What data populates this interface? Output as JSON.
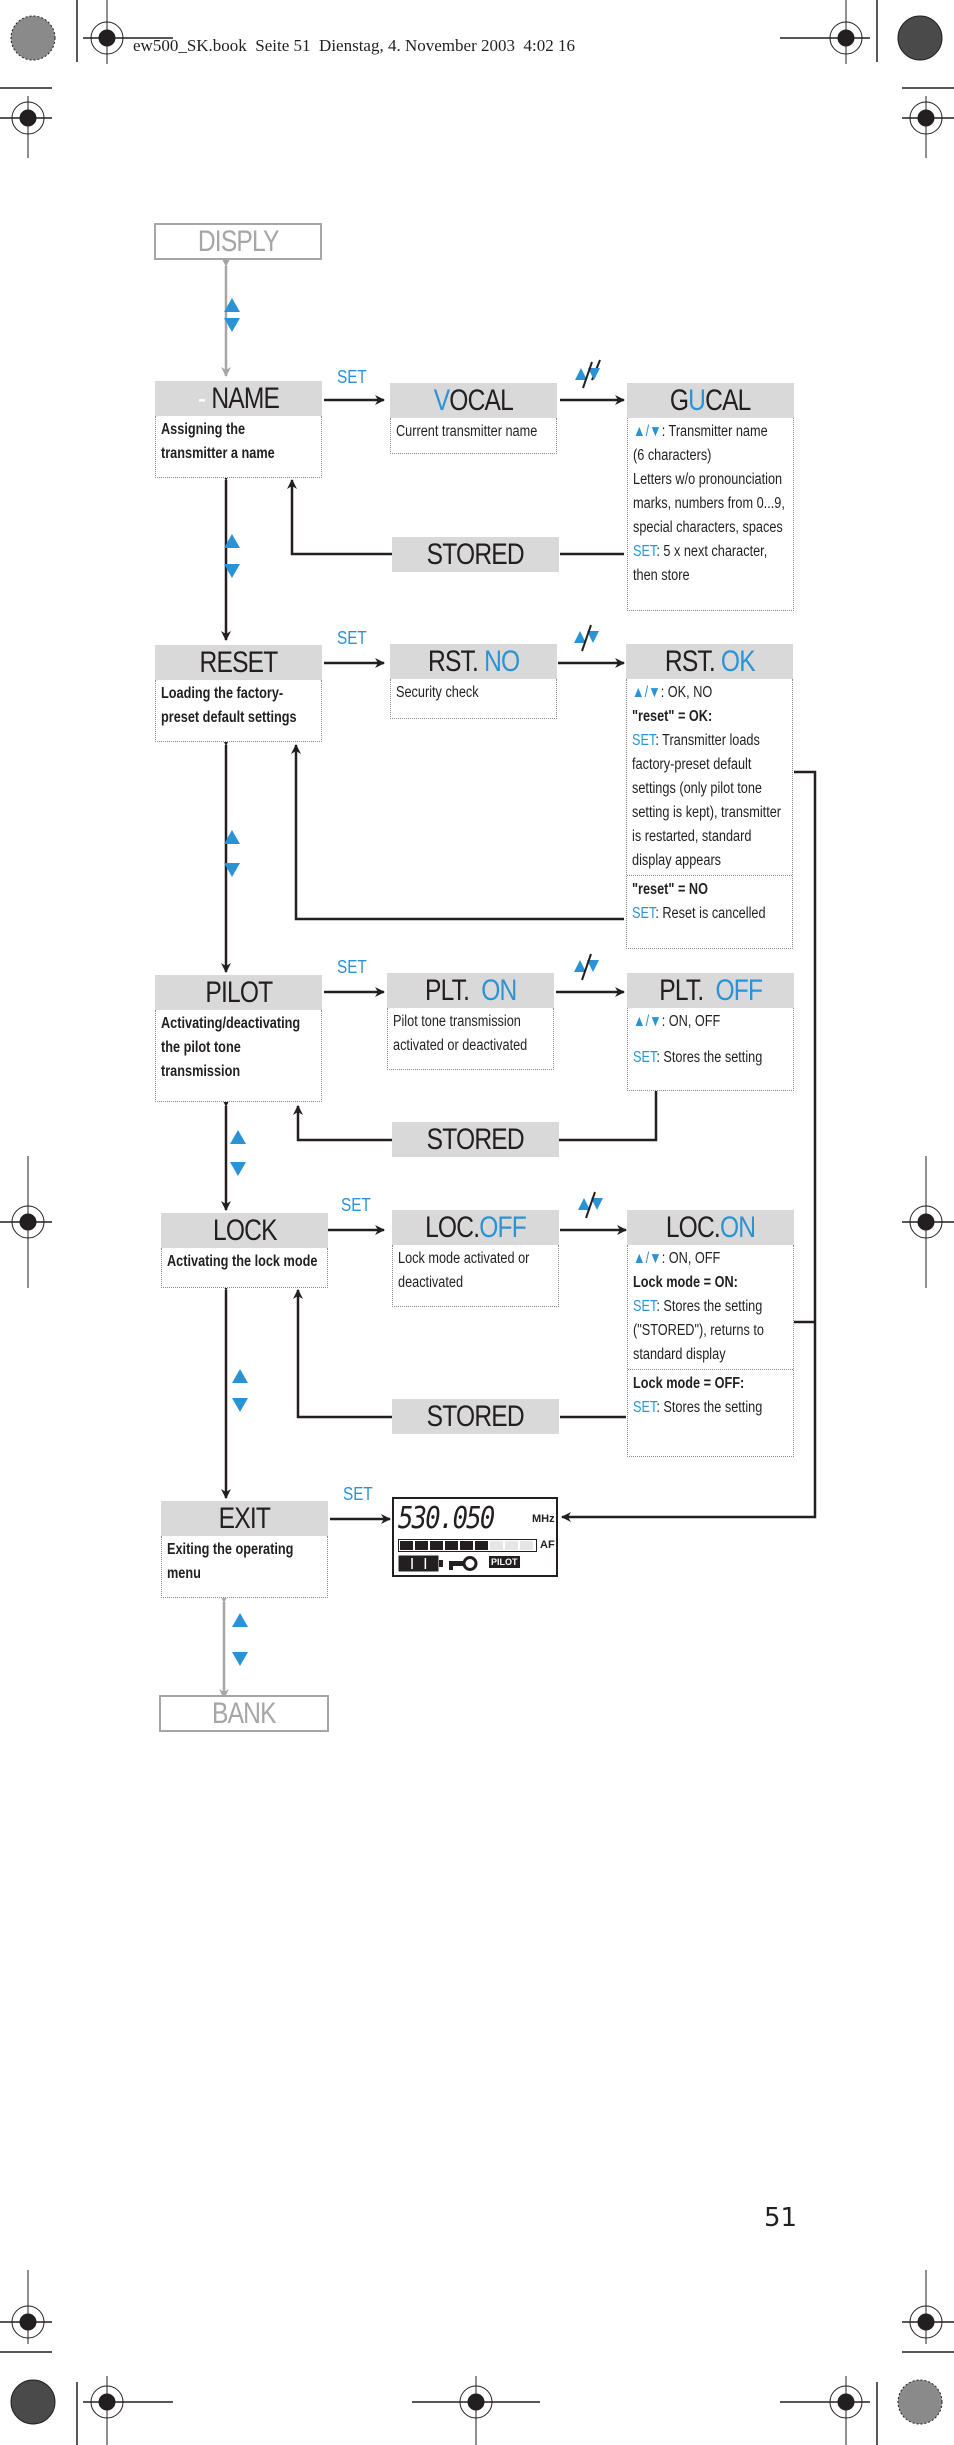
{
  "header": {
    "text": "ew500_SK.book  Seite 51  Dienstag, 4. November 2003  4:02 16"
  },
  "page_number": "51",
  "colors": {
    "accent_blue": "#2a93d5",
    "box_gray": "#d9d9d9",
    "ghost_gray": "#a6a6a6",
    "ink": "#231f20"
  },
  "nav": {
    "up_down_symbol": "▲/▼",
    "set": "SET"
  },
  "menu": {
    "prev_item": "DISPLY",
    "next_item": "BANK",
    "name": {
      "title_prefix": "-",
      "title": "NAME",
      "desc_lines": [
        "Assigning the",
        "transmitter a name"
      ],
      "step1": {
        "title_hl": "V",
        "title_rest": "OCAL",
        "desc": "Current transmitter name"
      },
      "step2": {
        "title_pre": "G",
        "title_hl": "U",
        "title_rest": "CAL",
        "lines": [
          ": Transmitter name",
          "(6 characters)",
          "Letters w/o pronounciation",
          "marks, numbers from 0...9,",
          "special characters, spaces"
        ],
        "set_text": ": 5 x next character,",
        "set_text2": "then store"
      },
      "stored": "STORED"
    },
    "reset": {
      "title": "RESET",
      "desc_lines": [
        "Loading the factory-",
        "preset default settings"
      ],
      "step1": {
        "title_pre": "RST. ",
        "title_hl": "NO",
        "desc": "Security check"
      },
      "step2": {
        "title_pre": "RST. ",
        "title_hl": "OK",
        "ud_text": ": OK, NO",
        "ok_head": "\"reset\" = OK:",
        "ok_set": ": Transmitter loads",
        "ok_lines": [
          "factory-preset default",
          "settings (only pilot tone",
          "setting is kept), transmitter",
          "is restarted, standard",
          "display appears"
        ],
        "no_head": "\"reset\" = NO",
        "no_set": ":  Reset is cancelled"
      }
    },
    "pilot": {
      "title": "PILOT",
      "desc_lines": [
        "Activating/deactivating",
        "the pilot tone",
        "transmission"
      ],
      "step1": {
        "title_pre": "PLT.  ",
        "title_hl": "ON",
        "desc_lines": [
          "Pilot tone transmission",
          "activated or deactivated"
        ]
      },
      "step2": {
        "title_pre": "PLT.  ",
        "title_hl": "OFF",
        "ud_text": ": ON, OFF",
        "set_text": ": Stores the setting"
      },
      "stored": "STORED"
    },
    "lock": {
      "title": "LOCK",
      "desc_lines": [
        "Activating the lock mode"
      ],
      "step1": {
        "title_pre": "LOC.",
        "title_hl": "OFF",
        "desc_lines": [
          "Lock mode activated or",
          "deactivated"
        ]
      },
      "step2": {
        "title_pre": "LOC.",
        "title_hl": "ON",
        "ud_text": ": ON, OFF",
        "on_head": "Lock mode = ON:",
        "on_set": ": Stores the setting",
        "on_lines": [
          "(\"STORED\"), returns to",
          "standard display"
        ],
        "off_head": "Lock mode = OFF:",
        "off_set": ": Stores the setting"
      },
      "stored": "STORED"
    },
    "exit": {
      "title": "EXIT",
      "desc_lines": [
        "Exiting the operating",
        "menu"
      ],
      "display": {
        "frequency": "530.050",
        "unit": "MHz",
        "af_label": "AF",
        "af_level": 0.7,
        "battery_bars": 3,
        "pilot_badge": "PILOT",
        "lock_icon": "key-icon"
      }
    }
  }
}
